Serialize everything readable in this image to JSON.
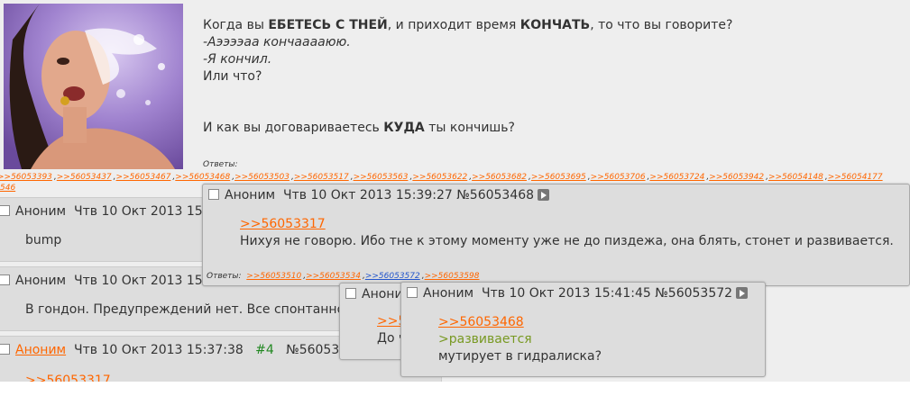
{
  "op": {
    "line1_a": "Когда вы ",
    "line1_b": "ЕБЕТЕСЬ С ТНЕЙ",
    "line1_c": ", и приходит время ",
    "line1_d": "КОНЧАТЬ",
    "line1_e": ", то что вы говорите?",
    "line2": "-Аээээаа кончааааюю.",
    "line3": "-Я кончил.",
    "line4": "Или что?",
    "line5_a": "И как вы договариваетесь ",
    "line5_b": "КУДА",
    "line5_c": " ты кончишь?",
    "replies_label": "Ответы:",
    "replies": [
      ">>56053393",
      ">>56053437",
      ">>56053467",
      ">>56053468",
      ">>56053503",
      ">>56053517",
      ">>56053563",
      ">>56053622",
      ">>56053682",
      ">>56053695",
      ">>56053706",
      ">>56053724",
      ">>56053942",
      ">>56054148",
      ">>56054177"
    ],
    "replies_tail": "546"
  },
  "post1": {
    "name": "Аноним",
    "date": "Чтв 10 Окт 2013 15:",
    "text": "bump"
  },
  "post2": {
    "name": "Аноним",
    "date": "Чтв 10 Окт 2013 15:",
    "text": "В гондон. Предупреждений нет. Все спонтанно"
  },
  "post3": {
    "name": "Аноним",
    "date": "Чтв 10 Окт 2013 15:37:38",
    "num": "#4",
    "id": "№56053",
    "link": ">>56053317"
  },
  "popup1": {
    "name": "Аноним",
    "date": "Чтв 10 Окт 2013 15:39:27",
    "id": "№56053468",
    "link": ">>56053317",
    "text": "Нихуя не говорю. Ибо тне к этому моменту уже не до пиздежа, она блять, стонет и развивается.",
    "replies_label": "Ответы:",
    "replies": [
      ">>56053510",
      ">>56053534",
      ">>56053572",
      ">>56053598"
    ]
  },
  "popup2": {
    "name": "Анони",
    "link_partial": ">>5",
    "text_partial": "До ч"
  },
  "popup3": {
    "name": "Аноним",
    "date": "Чтв 10 Окт 2013 15:41:45",
    "id": "№56053572",
    "link": ">>56053468",
    "greentext": ">развивается",
    "text": "мутирует в гидралиска?"
  },
  "colors": {
    "link": "#ff6600",
    "greentext": "#789922",
    "visited_link": "#2255cc"
  }
}
